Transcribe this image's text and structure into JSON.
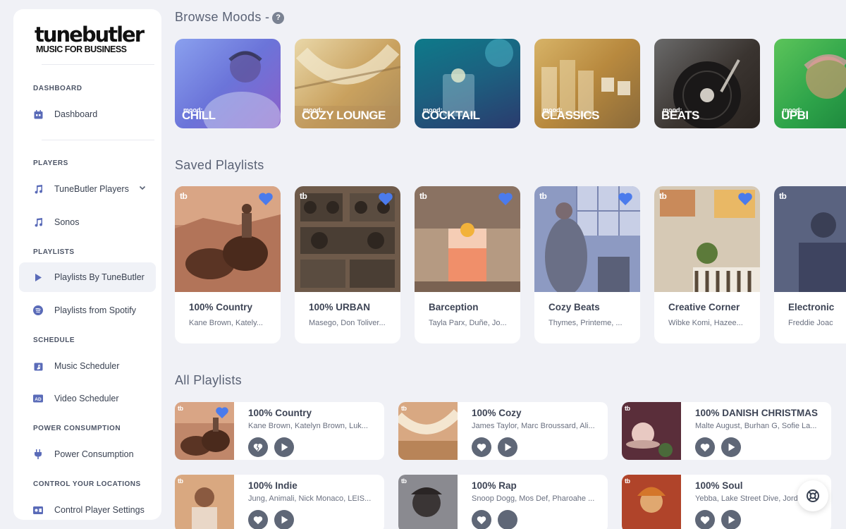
{
  "brand": {
    "name": "tunebutler",
    "tagline": "MUSIC FOR BUSINESS"
  },
  "sidebar": {
    "sections": [
      {
        "label": "DASHBOARD"
      },
      {
        "label": "PLAYERS"
      },
      {
        "label": "PLAYLISTS"
      },
      {
        "label": "SCHEDULE"
      },
      {
        "label": "POWER CONSUMPTION"
      },
      {
        "label": "CONTROL YOUR LOCATIONS"
      }
    ],
    "items": [
      {
        "label": "Dashboard",
        "icon": "dashboard-icon"
      },
      {
        "label": "TuneButler Players",
        "icon": "music-note-icon"
      },
      {
        "label": "Sonos",
        "icon": "music-note-icon"
      },
      {
        "label": "Playlists By TuneButler",
        "icon": "play-icon",
        "active": true
      },
      {
        "label": "Playlists from Spotify",
        "icon": "spotify-icon"
      },
      {
        "label": "Music Scheduler",
        "icon": "calendar-music-icon"
      },
      {
        "label": "Video Scheduler",
        "icon": "ad-icon"
      },
      {
        "label": "Power Consumption",
        "icon": "plug-icon"
      },
      {
        "label": "Control Player Settings",
        "icon": "speaker-icon"
      }
    ]
  },
  "browse_moods": {
    "title": "Browse Moods -",
    "help": "?",
    "moods": [
      {
        "tag": "mood:",
        "name": "CHILL"
      },
      {
        "tag": "mood:",
        "name": "COZY LOUNGE"
      },
      {
        "tag": "mood:",
        "name": "COCKTAIL"
      },
      {
        "tag": "mood:",
        "name": "CLASSICS"
      },
      {
        "tag": "mood:",
        "name": "BEATS"
      },
      {
        "tag": "mood:",
        "name": "UPBI"
      }
    ]
  },
  "saved_playlists": {
    "title": "Saved Playlists",
    "badge": "tb",
    "items": [
      {
        "title": "100% Country",
        "artists": "Kane Brown, Kately..."
      },
      {
        "title": "100% URBAN",
        "artists": "Masego, Don Toliver..."
      },
      {
        "title": "Barception",
        "artists": "Tayla Parx, Duñe, Jo..."
      },
      {
        "title": "Cozy Beats",
        "artists": "Thymes, Printeme, ..."
      },
      {
        "title": "Creative Corner",
        "artists": "Wibke Komi, Hazee..."
      },
      {
        "title": "Electronic",
        "artists": "Freddie Joac"
      }
    ]
  },
  "all_playlists": {
    "title": "All Playlists",
    "badge": "tb",
    "items": [
      {
        "title": "100% Country",
        "artists": "Kane Brown, Katelyn Brown, Luk..."
      },
      {
        "title": "100% Cozy",
        "artists": "James Taylor, Marc Broussard, Ali..."
      },
      {
        "title": "100% DANISH CHRISTMAS",
        "artists": "Malte August, Burhan G, Sofie La..."
      },
      {
        "title": "100% Indie",
        "artists": "Jung, Animali, Nick Monaco, LEIS..."
      },
      {
        "title": "100% Rap",
        "artists": "Snoop Dogg, Mos Def, Pharoahe ..."
      },
      {
        "title": "100% Soul",
        "artists": "Yebba, Lake Street Dive, Jorda..."
      }
    ]
  },
  "colors": {
    "accent": "#4b7bec",
    "button": "#5f6777",
    "sidebar_icon": "#5a6bb8"
  }
}
